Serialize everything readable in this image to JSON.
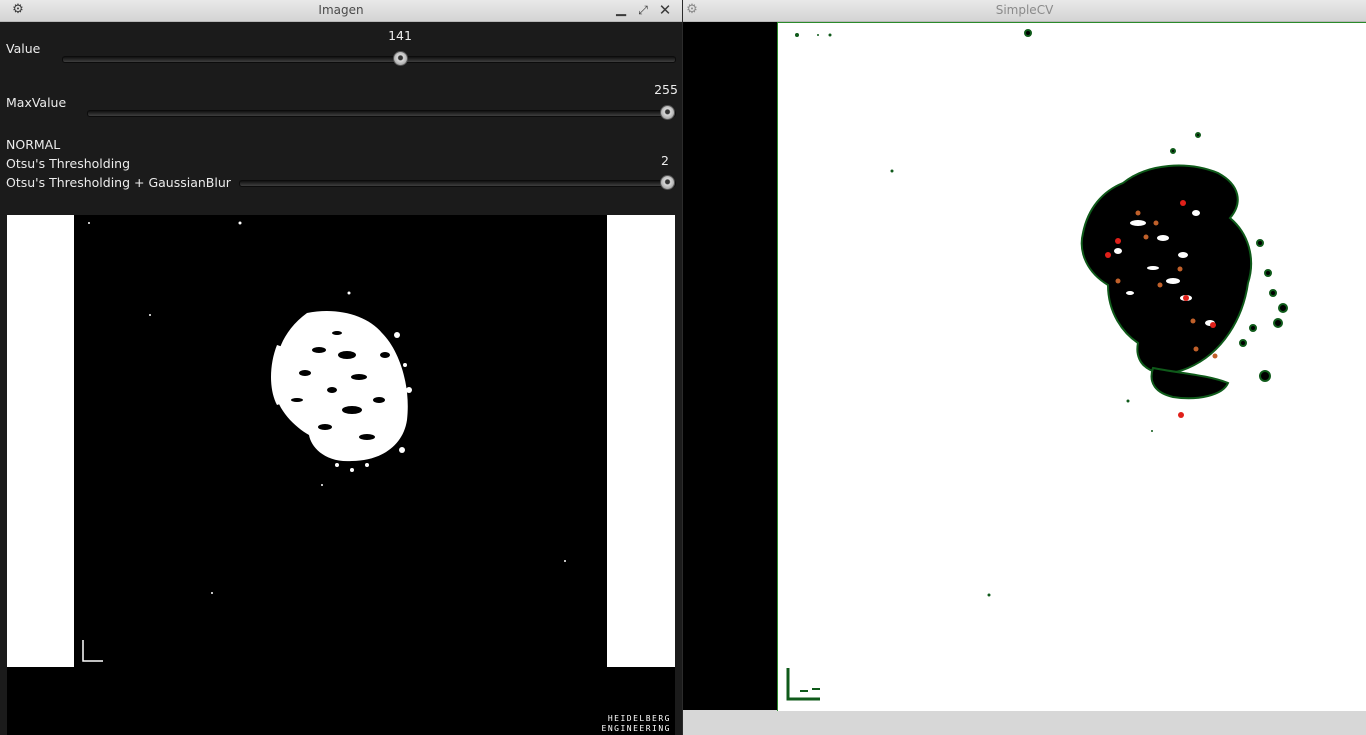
{
  "left_window": {
    "title": "Imagen",
    "controls": {
      "settings_icon": "gear-icon",
      "minimize_icon": "minimize-icon",
      "maximize_icon": "maximize-icon",
      "close_icon": "close-icon"
    },
    "sliders": [
      {
        "label": "Value",
        "value": "141",
        "fraction": 0.553
      },
      {
        "label": "MaxValue",
        "value": "255",
        "fraction": 1.0
      }
    ],
    "modes": {
      "item1": "NORMAL",
      "item2": "Otsu's Thresholding",
      "item3": "Otsu's Thresholding + GaussianBlur",
      "mode_value": "2",
      "mode_fraction": 1.0
    },
    "watermark": {
      "line1": "HEIDELBERG",
      "line2": "ENGINEERING"
    }
  },
  "right_window": {
    "title": "SimpleCV",
    "controls": {
      "settings_icon": "gear-icon"
    }
  },
  "colors": {
    "panel_bg": "#1b1b1b",
    "titlebar": "#dcdcdc",
    "contour": "#0f5a1a",
    "marker_red": "#e0201a",
    "marker_orange": "#c0602a"
  }
}
